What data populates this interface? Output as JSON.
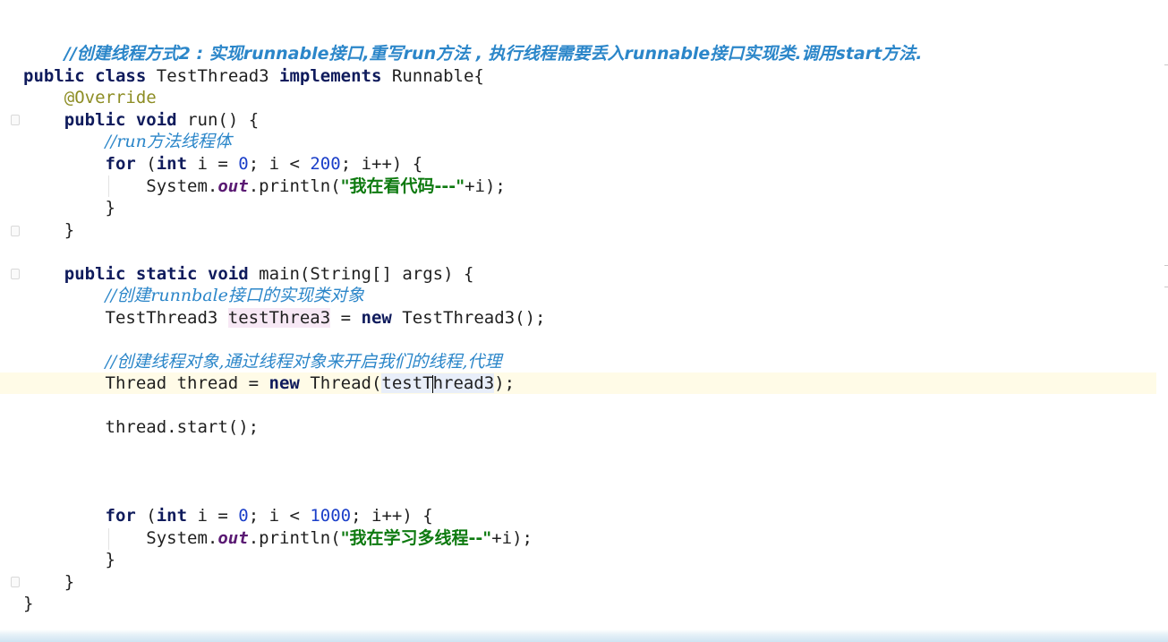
{
  "editor": {
    "header_comment": "//创建线程方式2 : 实现runnable接口,重写run方法 , 执行线程需要丢入runnable接口实现类.调用start方法.",
    "code": {
      "kw_public": "public",
      "kw_class": "class",
      "class_name": "TestThread3",
      "kw_implements": "implements",
      "interface_name": "Runnable{",
      "annotation": "@Override",
      "kw_void": "void",
      "run_sig": "run() {",
      "comment_run_body": "//run方法线程体",
      "kw_for": "for",
      "kw_int": "int",
      "for1_part1": " i = ",
      "for1_zero": "0",
      "for1_part2": "; i < ",
      "for1_limit": "200",
      "for1_part3": "; i++) {",
      "paren_open": " (",
      "system": "System.",
      "out": "out",
      "println_open": ".println(",
      "print1_str": "\"我在看代码---\"",
      "print_tail": "+i);",
      "close_brace": "}",
      "kw_static": "static",
      "main_sig": "main(String[] args) {",
      "comment_create_impl": "//创建runnbale接口的实现类对象",
      "decl_type": "TestThread3 ",
      "var_test_a": "testThrea",
      "var_test_b": "3",
      "assign": " = ",
      "kw_new": "new",
      "ctor_call": " TestThread3();",
      "comment_thread": "//创建线程对象,通过线程对象来开启我们的线程,代理",
      "thread_decl": "Thread thread = ",
      "thread_ctor_open": " Thread(",
      "arg_a": "testT",
      "arg_b": "hread3",
      "thread_ctor_close": ");",
      "start_call": "thread.start();",
      "for2_limit": "1000",
      "print2_str": "\"我在学习多线程--\""
    }
  }
}
